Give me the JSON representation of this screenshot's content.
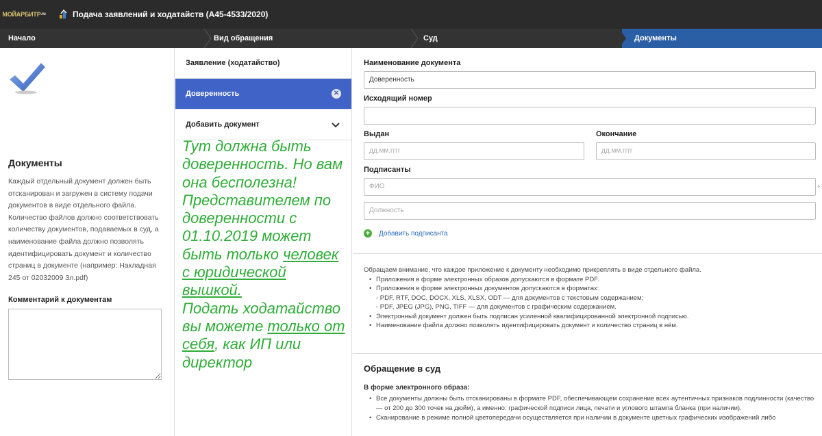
{
  "header": {
    "logo": "МОЙАРБИТР",
    "logo_sup": ".ru",
    "title": "Подача заявлений и ходатайств  (А45-4533/2020)"
  },
  "breadcrumbs": [
    "Начало",
    "Вид обращения",
    "Суд",
    "Документы"
  ],
  "left": {
    "title": "Документы",
    "text": "Каждый отдельный документ должен быть отсканирован и загружен в систему подачи документов в виде отдельного файла. Количество файлов должно соответствовать количеству документов, подаваемых в суд, а наименование файла должно позволять идентифицировать документ и количество страниц в документе (например: Накладная 245 от 02032009 3л.pdf)",
    "comment_label": "Комментарий к документам"
  },
  "middle": {
    "items": [
      {
        "label": "Заявление (ходатайство)"
      },
      {
        "label": "Доверенность"
      },
      {
        "label": "Добавить документ"
      }
    ],
    "note": {
      "p1": "Тут должна быть доверенность. Но вам она бесполезна! Представителем по доверенности с 01.10.2019 может быть только ",
      "p1u": "человек с юридической вышкой.",
      "p2": "Подать ходатайство вы можете ",
      "p2u": "только от себя",
      "p3": ", как ИП или директор"
    }
  },
  "form": {
    "name_label": "Наименование документа",
    "name_value": "Доверенность",
    "number_label": "Исходящий номер",
    "number_value": "",
    "issued_label": "Выдан",
    "issued_placeholder": "дд.мм.гггг",
    "end_label": "Окончание",
    "end_placeholder": "дд.мм.гггг",
    "signers_label": "Подписанты",
    "fio_placeholder": "ФИО",
    "position_placeholder": "Должность",
    "add_signer": "Добавить подписанта"
  },
  "info": {
    "intro": "Обращаем внимание, что каждое приложение к документу необходимо прикреплять в виде отдельного файла.",
    "b1": "Приложения в форме электронных образов допускаются в формате PDF.",
    "b2": "Приложения в форме электронных документов допускаются в форматах:",
    "b2a": "- PDF, RTF, DOC, DOCX, XLS, XLSX, ODT — для документов с текстовым содержанием;",
    "b2b": "- PDF, JPEG (JPG), PNG, TIFF — для документов с графическим содержанием.",
    "b3": "Электронный документ должен быть подписан усиленной квалифицированной электронной подписью.",
    "b4": "Наименование файла должно позволять идентифицировать документ и количество страниц в нём."
  },
  "court": {
    "title": "Обращение в суд",
    "subtitle": "В форме электронного образа:",
    "b1": "Все документы должны быть отсканированы в формате PDF, обеспечивающем сохранение всех аутентичных признаков подлинности (качество — от 200 до 300 точек на дюйм), а именно: графической подписи лица, печати и углового штампа бланка (при наличии).",
    "b2": "Сканирование в режиме полной цветопередачи осуществляется при наличии в документе цветных графических изображений либо"
  }
}
